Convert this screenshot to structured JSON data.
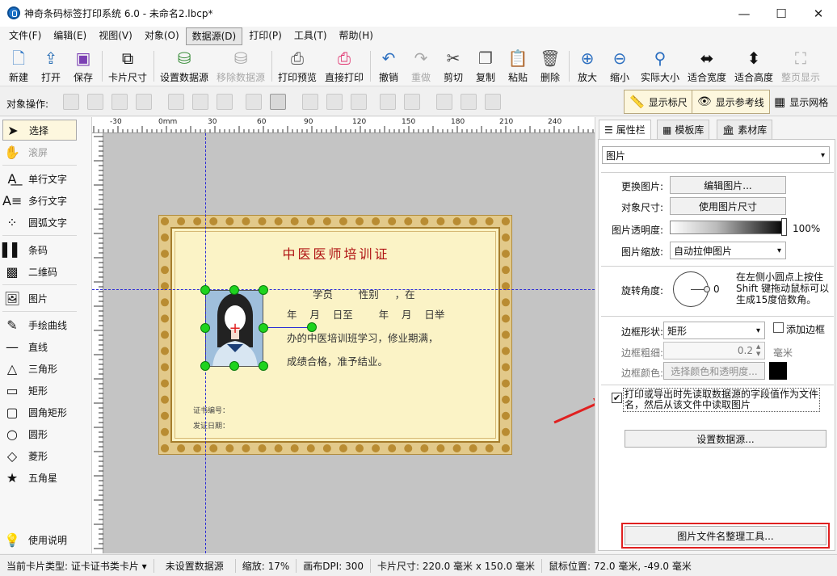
{
  "window": {
    "title": "神奇条码标签打印系统 6.0 - 未命名2.lbcp*",
    "minimize": "—",
    "maximize": "☐",
    "close": "✕"
  },
  "menu": [
    "文件(F)",
    "编辑(E)",
    "视图(V)",
    "对象(O)",
    "数据源(D)",
    "打印(P)",
    "工具(T)",
    "帮助(H)"
  ],
  "toolbar": {
    "new": "新建",
    "open": "打开",
    "save": "保存",
    "card_size": "卡片尺寸",
    "set_datasource": "设置数据源",
    "remove_datasource": "移除数据源",
    "print_preview": "打印预览",
    "direct_print": "直接打印",
    "undo": "撤销",
    "redo": "重做",
    "cut": "剪切",
    "copy": "复制",
    "paste": "粘贴",
    "delete": "删除",
    "zoom_in": "放大",
    "zoom_out": "缩小",
    "actual_size": "实际大小",
    "fit_width": "适合宽度",
    "fit_height": "适合高度",
    "fit_page": "整页显示"
  },
  "ops": {
    "label": "对象操作:",
    "show_ruler": "显示标尺",
    "show_guides": "显示参考线",
    "show_grid": "显示网格"
  },
  "tools": {
    "select": "选择",
    "scroll": "滚屏",
    "single_text": "单行文字",
    "multi_text": "多行文字",
    "arc_text": "圆弧文字",
    "barcode": "条码",
    "qrcode": "二维码",
    "image": "图片",
    "freehand": "手绘曲线",
    "line": "直线",
    "triangle": "三角形",
    "rect": "矩形",
    "round_rect": "圆角矩形",
    "circle": "圆形",
    "diamond": "菱形",
    "star": "五角星",
    "help": "使用说明"
  },
  "ruler": {
    "h_ticks": [
      "-30",
      "0mm",
      "30",
      "60",
      "90",
      "120",
      "150",
      "180",
      "210",
      "240"
    ],
    "v_ticks": [
      "30",
      "60",
      "90",
      "120",
      "150"
    ]
  },
  "certificate": {
    "title": "中医医师培训证",
    "line1": "学员        性别     ，在",
    "line2": "年    月    日至        年    月    日举",
    "line3": "办的中医培训班学习，修业期满，",
    "line4": "成绩合格，准予结业。",
    "cert_no": "证书编号：",
    "issue_date": "发证日期："
  },
  "panel": {
    "tabs": [
      "属性栏",
      "模板库",
      "素材库"
    ],
    "object_type": "图片",
    "replace_label": "更换图片:",
    "edit_image": "编辑图片...",
    "size_label": "对象尺寸:",
    "use_image_size": "使用图片尺寸",
    "opacity_label": "图片透明度:",
    "opacity_value": "100%",
    "scale_label": "图片缩放:",
    "scale_value": "自动拉伸图片",
    "rotate_label": "旋转角度:",
    "rotate_value": "0",
    "rotate_hint": "在左侧小圆点上按住Shift 键拖动鼠标可以生成15度倍数角。",
    "border_shape_label": "边框形状:",
    "border_shape_value": "矩形",
    "add_border": "添加边框",
    "border_width_label": "边框粗细:",
    "border_width_value": "0.2",
    "border_width_unit": "毫米",
    "border_color_label": "边框颜色:",
    "border_color_btn": "选择颜色和透明度...",
    "read_from_datasource": "打印或导出时先读取数据源的字段值作为文件名，然后从该文件中读取图片",
    "read_from_datasource_checked": true,
    "set_datasource_btn": "设置数据源...",
    "organize_tool_btn": "图片文件名整理工具..."
  },
  "status": {
    "card_type": "当前卡片类型: 证卡证书类卡片 ▾",
    "datasource": "未设置数据源",
    "zoom": "缩放: 17%",
    "dpi": "画布DPI: 300",
    "card_size": "卡片尺寸: 220.0 毫米 x 150.0 毫米",
    "mouse_pos": "鼠标位置: 72.0 毫米, -49.0 毫米"
  },
  "colors": {
    "accent_red": "#e02020",
    "cert_title": "#b01414",
    "handle": "#1ed31e"
  }
}
